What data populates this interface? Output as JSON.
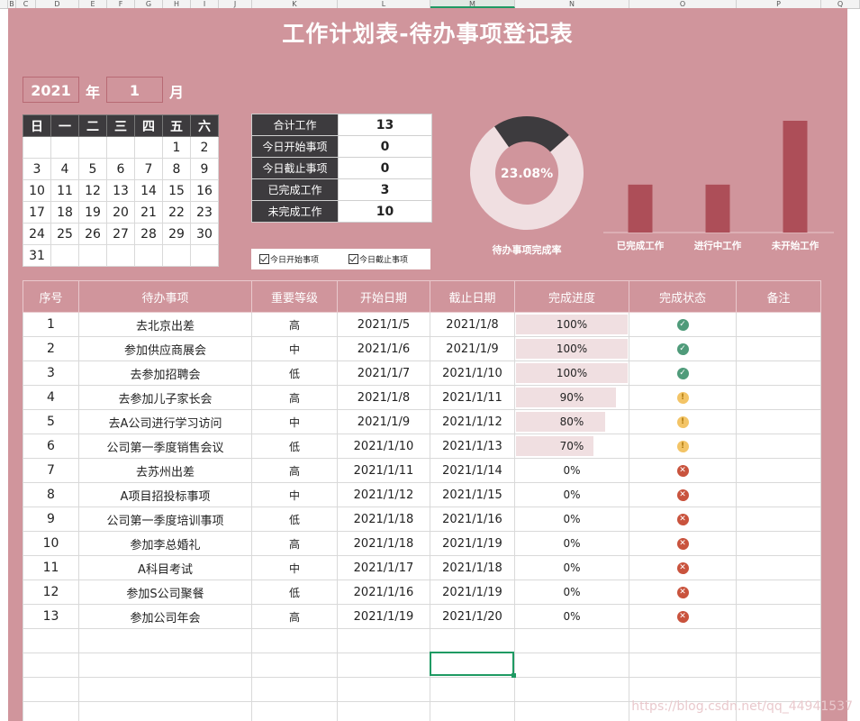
{
  "columns": [
    "B",
    "C",
    "D",
    "E",
    "F",
    "G",
    "H",
    "I",
    "J",
    "K",
    "L",
    "M",
    "N",
    "O",
    "P",
    "Q"
  ],
  "title": "工作计划表-待办事项登记表",
  "year": "2021",
  "year_label": "年",
  "month": "1",
  "month_label": "月",
  "calendar": {
    "weekdays": [
      "日",
      "一",
      "二",
      "三",
      "四",
      "五",
      "六"
    ],
    "weeks": [
      [
        "",
        "",
        "",
        "",
        "",
        "1",
        "2"
      ],
      [
        "3",
        "4",
        "5",
        "6",
        "7",
        "8",
        "9"
      ],
      [
        "10",
        "11",
        "12",
        "13",
        "14",
        "15",
        "16"
      ],
      [
        "17",
        "18",
        "19",
        "20",
        "21",
        "22",
        "23"
      ],
      [
        "24",
        "25",
        "26",
        "27",
        "28",
        "29",
        "30"
      ],
      [
        "31",
        "",
        "",
        "",
        "",
        "",
        ""
      ]
    ]
  },
  "summary": [
    {
      "label": "合计工作",
      "value": "13"
    },
    {
      "label": "今日开始事项",
      "value": "0"
    },
    {
      "label": "今日截止事项",
      "value": "0"
    },
    {
      "label": "已完成工作",
      "value": "3"
    },
    {
      "label": "未完成工作",
      "value": "10"
    }
  ],
  "checkboxes": [
    {
      "label": "今日开始事项",
      "checked": true
    },
    {
      "label": "今日截止事项",
      "checked": true
    }
  ],
  "chart_data": [
    {
      "type": "pie",
      "center_label": "23.08%",
      "caption": "待办事项完成率",
      "values": [
        23.08,
        76.92
      ]
    },
    {
      "type": "bar",
      "categories": [
        "已完成工作",
        "进行中工作",
        "未开始工作"
      ],
      "values": [
        3,
        3,
        7
      ],
      "color": "#ad4e58"
    }
  ],
  "table": {
    "headers": [
      "序号",
      "待办事项",
      "重要等级",
      "开始日期",
      "截止日期",
      "完成进度",
      "完成状态",
      "备注"
    ],
    "rows": [
      {
        "no": "1",
        "task": "去北京出差",
        "level": "高",
        "start": "2021/1/5",
        "end": "2021/1/8",
        "progress": "100%",
        "pct": 100,
        "status": "ok",
        "note": ""
      },
      {
        "no": "2",
        "task": "参加供应商展会",
        "level": "中",
        "start": "2021/1/6",
        "end": "2021/1/9",
        "progress": "100%",
        "pct": 100,
        "status": "ok",
        "note": ""
      },
      {
        "no": "3",
        "task": "去参加招聘会",
        "level": "低",
        "start": "2021/1/7",
        "end": "2021/1/10",
        "progress": "100%",
        "pct": 100,
        "status": "ok",
        "note": ""
      },
      {
        "no": "4",
        "task": "去参加儿子家长会",
        "level": "高",
        "start": "2021/1/8",
        "end": "2021/1/11",
        "progress": "90%",
        "pct": 90,
        "status": "warn",
        "note": ""
      },
      {
        "no": "5",
        "task": "去A公司进行学习访问",
        "level": "中",
        "start": "2021/1/9",
        "end": "2021/1/12",
        "progress": "80%",
        "pct": 80,
        "status": "warn",
        "note": ""
      },
      {
        "no": "6",
        "task": "公司第一季度销售会议",
        "level": "低",
        "start": "2021/1/10",
        "end": "2021/1/13",
        "progress": "70%",
        "pct": 70,
        "status": "warn",
        "note": ""
      },
      {
        "no": "7",
        "task": "去苏州出差",
        "level": "高",
        "start": "2021/1/11",
        "end": "2021/1/14",
        "progress": "0%",
        "pct": 0,
        "status": "no",
        "note": ""
      },
      {
        "no": "8",
        "task": "A项目招投标事项",
        "level": "中",
        "start": "2021/1/12",
        "end": "2021/1/15",
        "progress": "0%",
        "pct": 0,
        "status": "no",
        "note": ""
      },
      {
        "no": "9",
        "task": "公司第一季度培训事项",
        "level": "低",
        "start": "2021/1/18",
        "end": "2021/1/16",
        "progress": "0%",
        "pct": 0,
        "status": "no",
        "note": ""
      },
      {
        "no": "10",
        "task": "参加李总婚礼",
        "level": "高",
        "start": "2021/1/18",
        "end": "2021/1/19",
        "progress": "0%",
        "pct": 0,
        "status": "no",
        "note": ""
      },
      {
        "no": "11",
        "task": "A科目考试",
        "level": "中",
        "start": "2021/1/17",
        "end": "2021/1/18",
        "progress": "0%",
        "pct": 0,
        "status": "no",
        "note": ""
      },
      {
        "no": "12",
        "task": "参加S公司聚餐",
        "level": "低",
        "start": "2021/1/16",
        "end": "2021/1/19",
        "progress": "0%",
        "pct": 0,
        "status": "no",
        "note": ""
      },
      {
        "no": "13",
        "task": "参加公司年会",
        "level": "高",
        "start": "2021/1/19",
        "end": "2021/1/20",
        "progress": "0%",
        "pct": 0,
        "status": "no",
        "note": ""
      }
    ],
    "empty_rows": 4
  },
  "status_icons": {
    "ok": "check-circle-icon",
    "warn": "exclamation-circle-icon",
    "no": "x-circle-icon"
  },
  "watermark": "https://blog.csdn.net/qq_44941537"
}
